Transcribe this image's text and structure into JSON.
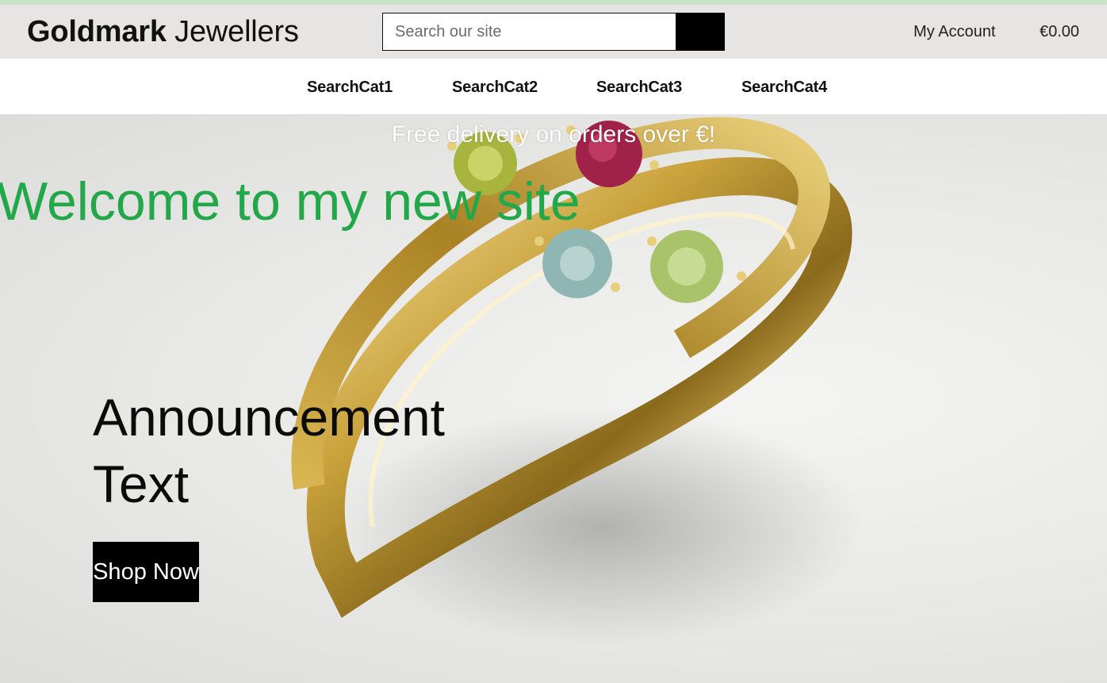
{
  "header": {
    "logo_bold": "Goldmark",
    "logo_light": "Jewellers",
    "search": {
      "placeholder": "Search our site",
      "value": "",
      "button_icon": "search-icon"
    },
    "account_label": "My Account",
    "cart_total": "€0.00"
  },
  "nav": {
    "items": [
      {
        "label": "SearchCat1"
      },
      {
        "label": "SearchCat2"
      },
      {
        "label": "SearchCat3"
      },
      {
        "label": "SearchCat4"
      }
    ]
  },
  "hero": {
    "delivery_banner": "Free delivery on orders over €!",
    "welcome": "Welcome to my new site",
    "announcement": "Announcement Text",
    "shop_button": "Shop Now"
  },
  "colors": {
    "accent_bar": "#c9e3c9",
    "header_bg": "#e6e5e3",
    "welcome_green": "#22a84a",
    "button_black": "#000000"
  }
}
